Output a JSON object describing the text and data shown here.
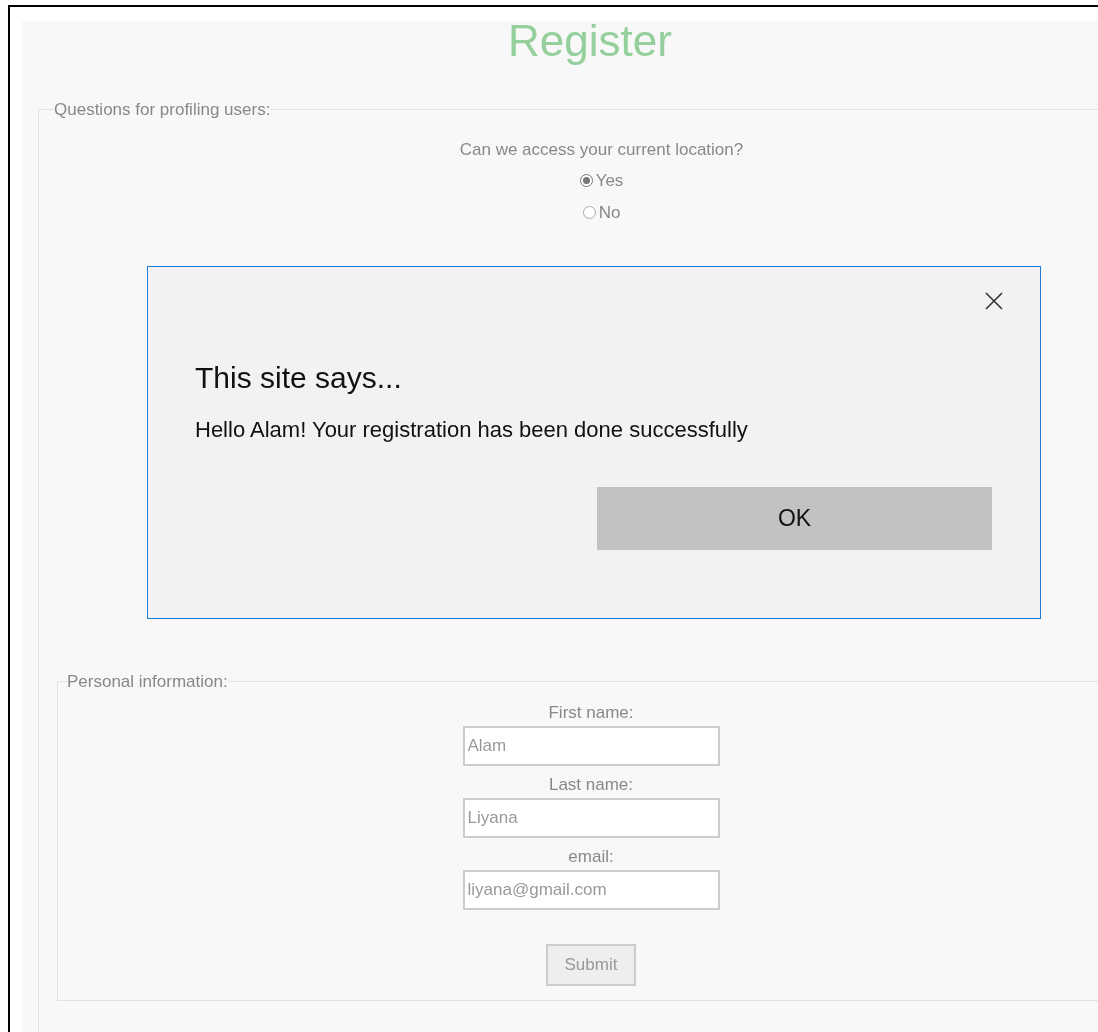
{
  "page": {
    "title": "Register"
  },
  "profiling": {
    "legend": "Questions for profiling users:",
    "questions": [
      {
        "prompt": "Can we access your current location?",
        "options": [
          {
            "label": "Yes",
            "selected": true
          },
          {
            "label": "No",
            "selected": false
          }
        ]
      }
    ]
  },
  "personal": {
    "legend": "Personal information:",
    "fields": [
      {
        "label": "First name:",
        "value": "Alam"
      },
      {
        "label": "Last name:",
        "value": "Liyana"
      },
      {
        "label": "email:",
        "value": "liyana@gmail.com"
      }
    ],
    "submit": "Submit"
  },
  "dialog": {
    "title": "This site says...",
    "message": "Hello Alam! Your registration has been done successfully",
    "ok": "OK"
  }
}
